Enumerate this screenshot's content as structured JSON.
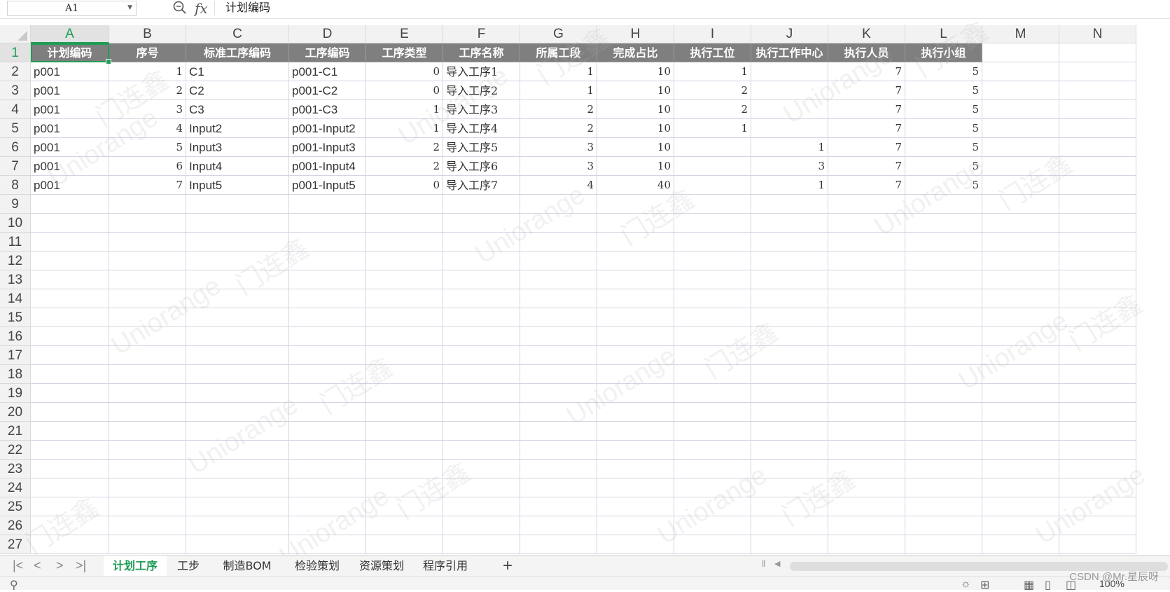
{
  "formula_bar": {
    "name_box": "A1",
    "fx_label": "fx",
    "formula_value": "计划编码"
  },
  "columns": [
    "A",
    "B",
    "C",
    "D",
    "E",
    "F",
    "G",
    "H",
    "I",
    "J",
    "K",
    "L",
    "M",
    "N"
  ],
  "rows": [
    "1",
    "2",
    "3",
    "4",
    "5",
    "6",
    "7",
    "8",
    "9",
    "10",
    "11",
    "12",
    "13",
    "14",
    "15",
    "16",
    "17",
    "18",
    "19",
    "20",
    "21",
    "22",
    "23",
    "24",
    "25",
    "26",
    "27"
  ],
  "header_row": [
    "计划编码",
    "序号",
    "标准工序编码",
    "工序编码",
    "工序类型",
    "工序名称",
    "所属工段",
    "完成占比",
    "执行工位",
    "执行工作中心",
    "执行人员",
    "执行小组"
  ],
  "data_rows": [
    [
      "p001",
      "1",
      "C1",
      "p001-C1",
      "0",
      "导入工序1",
      "1",
      "10",
      "1",
      "",
      "7",
      "5"
    ],
    [
      "p001",
      "2",
      "C2",
      "p001-C2",
      "0",
      "导入工序2",
      "1",
      "10",
      "2",
      "",
      "7",
      "5"
    ],
    [
      "p001",
      "3",
      "C3",
      "p001-C3",
      "1",
      "导入工序3",
      "2",
      "10",
      "2",
      "",
      "7",
      "5"
    ],
    [
      "p001",
      "4",
      "Input2",
      "p001-Input2",
      "1",
      "导入工序4",
      "2",
      "10",
      "1",
      "",
      "7",
      "5"
    ],
    [
      "p001",
      "5",
      "Input3",
      "p001-Input3",
      "2",
      "导入工序5",
      "3",
      "10",
      "",
      "1",
      "7",
      "5"
    ],
    [
      "p001",
      "6",
      "Input4",
      "p001-Input4",
      "2",
      "导入工序6",
      "3",
      "10",
      "",
      "3",
      "7",
      "5"
    ],
    [
      "p001",
      "7",
      "Input5",
      "p001-Input5",
      "0",
      "导入工序7",
      "4",
      "40",
      "",
      "1",
      "7",
      "5"
    ]
  ],
  "sheet_tabs": [
    "计划工序",
    "工步",
    "制造BOM",
    "检验策划",
    "资源策划",
    "程序引用"
  ],
  "active_tab": "计划工序",
  "add_sheet": "+",
  "watermark_texts": [
    "Uniorange",
    "门连鑫"
  ],
  "credit": "CSDN @Mr.星辰呀",
  "zoom": "100%",
  "accent_color": "#1f9d55",
  "header_fill": "#7f7f7f"
}
